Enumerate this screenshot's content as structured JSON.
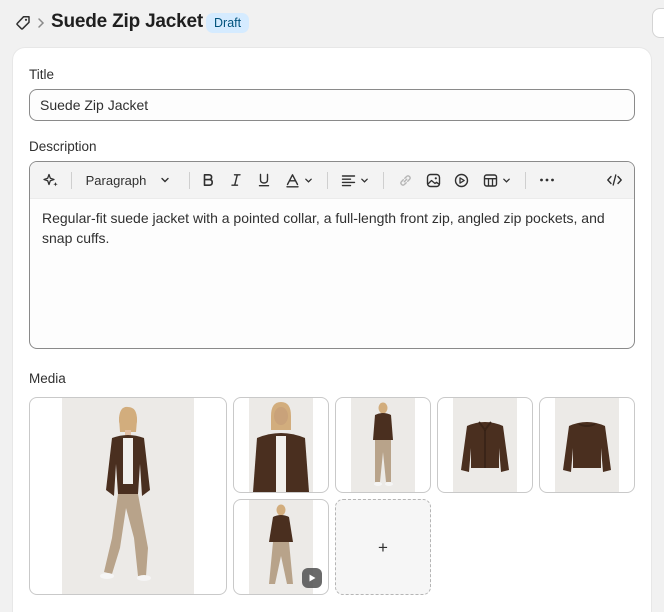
{
  "header": {
    "title": "Suede Zip Jacket",
    "status_badge": "Draft",
    "icon": "tag-icon",
    "chevron_icon": "chevron-right-icon"
  },
  "form": {
    "title_label": "Title",
    "title_value": "Suede Zip Jacket",
    "description_label": "Description",
    "toolbar": {
      "ai_icon": "magic-sparkle-icon",
      "format_select": "Paragraph",
      "items": [
        "bold-icon",
        "italic-icon",
        "underline-icon",
        "text-color-icon",
        "align-icon",
        "link-icon",
        "image-icon",
        "video-icon",
        "table-icon",
        "more-icon",
        "code-icon"
      ]
    },
    "description_text": "Regular-fit suede jacket with a pointed collar, a full-length front zip, angled zip pockets, and snap cuffs.",
    "media_label": "Media",
    "media_add_label": "+"
  },
  "colors": {
    "badge_bg": "#d5ebff",
    "badge_text": "#00527c",
    "jacket_brown": "#4a2f1f",
    "pants_khaki": "#b8a38a"
  }
}
